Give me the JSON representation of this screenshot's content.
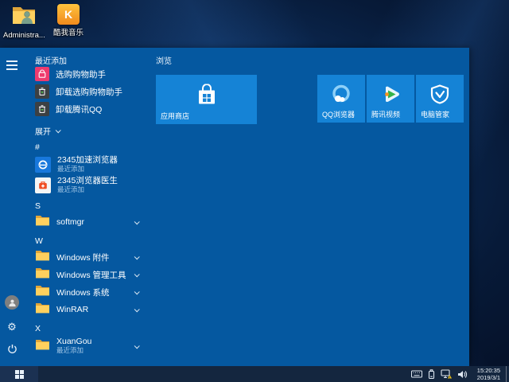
{
  "desktop": {
    "icons": [
      {
        "label": "Administra...",
        "icon": "user-folder-icon"
      },
      {
        "label": "酷我音乐",
        "icon": "kuwo-music-icon",
        "glyph": "K"
      }
    ]
  },
  "start_menu": {
    "recent_header": "最近添加",
    "recent_items": [
      {
        "label": "选购购物助手",
        "icon": "shopping-bag-icon",
        "color": "#ee3a6e"
      },
      {
        "label": "卸载选购购物助手",
        "icon": "uninstall-trash-icon"
      },
      {
        "label": "卸载腾讯QQ",
        "icon": "uninstall-trash-icon"
      }
    ],
    "expand_label": "展开",
    "sections": [
      {
        "letter": "#",
        "items": [
          {
            "label": "2345加速浏览器",
            "sublabel": "最近添加",
            "icon": "browser-2345-icon"
          },
          {
            "label": "2345浏览器医生",
            "sublabel": "最近添加",
            "icon": "doctor-2345-icon"
          }
        ]
      },
      {
        "letter": "S",
        "items": [
          {
            "label": "softmgr",
            "icon": "folder-icon",
            "expandable": true
          }
        ]
      },
      {
        "letter": "W",
        "items": [
          {
            "label": "Windows 附件",
            "icon": "folder-icon",
            "expandable": true
          },
          {
            "label": "Windows 管理工具",
            "icon": "folder-icon",
            "expandable": true
          },
          {
            "label": "Windows 系统",
            "icon": "folder-icon",
            "expandable": true
          },
          {
            "label": "WinRAR",
            "icon": "folder-icon",
            "expandable": true
          }
        ]
      },
      {
        "letter": "X",
        "items": [
          {
            "label": "XuanGou",
            "sublabel": "最近添加",
            "icon": "folder-icon",
            "expandable": true
          }
        ]
      }
    ],
    "tiles_group_label": "浏览",
    "tiles": [
      {
        "label": "应用商店",
        "size": "wide",
        "icon": "windows-store-icon"
      },
      {
        "label": "QQ浏览器",
        "size": "medium",
        "icon": "qq-browser-icon"
      },
      {
        "label": "腾讯视频",
        "size": "medium",
        "icon": "tencent-video-icon"
      },
      {
        "label": "电脑管家",
        "size": "medium",
        "icon": "pc-manager-icon"
      }
    ]
  },
  "taskbar": {
    "time": "15:20:35",
    "date": "2019/3/1",
    "tray_icons": [
      "touch-keyboard-icon",
      "usb-device-icon",
      "network-warning-icon",
      "speaker-icon"
    ]
  },
  "colors": {
    "menu_bg": "#0558a0",
    "tile_bg": "#1583d6",
    "taskbar_bg": "#14263f",
    "accent_pink": "#ee3a6e",
    "subtitle_text": "#9dc3e4"
  }
}
